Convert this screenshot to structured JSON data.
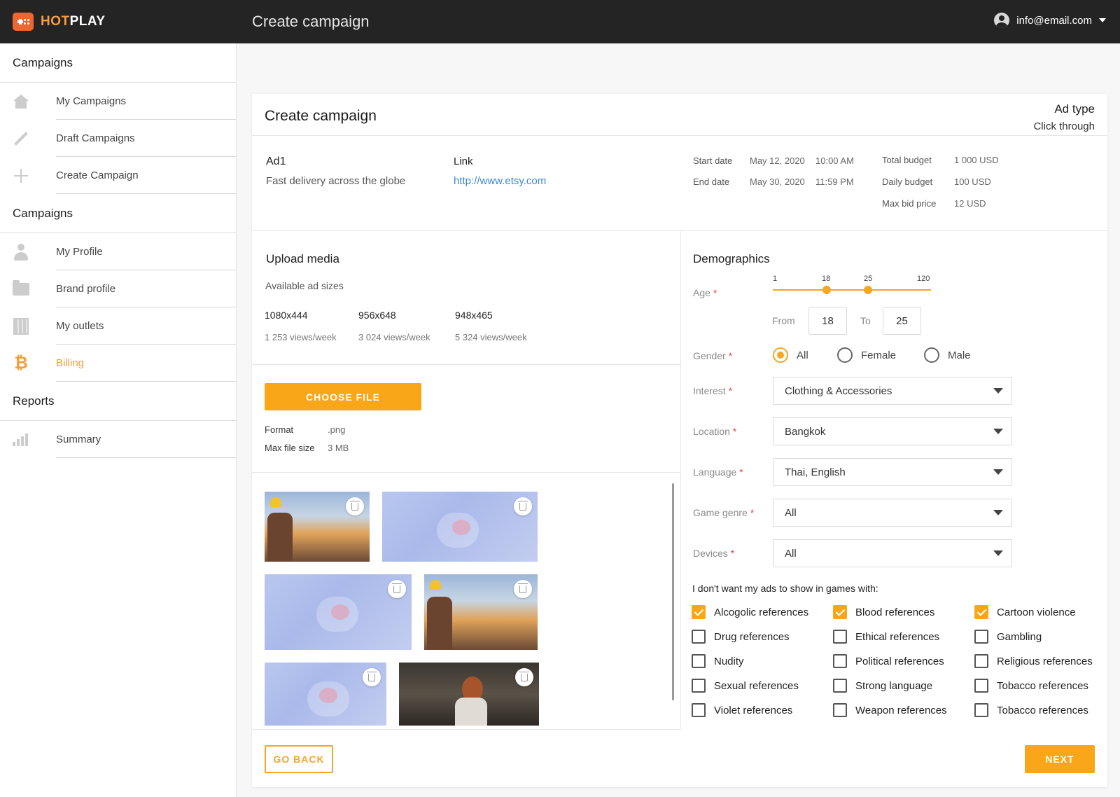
{
  "brand": {
    "hot": "HOT",
    "play": "PLAY",
    "accent": "#f59d3f"
  },
  "topbar": {
    "title": "Create campaign",
    "user_email": "info@email.com"
  },
  "sidebar": {
    "sections": [
      {
        "title": "Campaigns",
        "items": [
          {
            "label": "My Campaigns",
            "icon": "home-icon"
          },
          {
            "label": "Draft Campaigns",
            "icon": "pencil-icon"
          },
          {
            "label": "Create Campaign",
            "icon": "plus-icon"
          }
        ]
      },
      {
        "title": "Campaigns",
        "items": [
          {
            "label": "My Profile",
            "icon": "user-icon"
          },
          {
            "label": "Brand profile",
            "icon": "folder-icon"
          },
          {
            "label": "My outlets",
            "icon": "building-icon"
          },
          {
            "label": "Billing",
            "icon": "bitcoin-icon",
            "active": true
          }
        ]
      },
      {
        "title": "Reports",
        "items": [
          {
            "label": "Summary",
            "icon": "bar-chart-icon"
          }
        ]
      }
    ]
  },
  "card": {
    "title": "Create campaign",
    "ad_type_label": "Ad type",
    "ad_type_value": "Click through"
  },
  "summary": {
    "ad_name": "Ad1",
    "ad_desc": "Fast delivery across the globe",
    "link_label": "Link",
    "link_url": "http://www.etsy.com",
    "start_label": "Start date",
    "start_date": "May 12, 2020",
    "start_time": "10:00 AM",
    "end_label": "End date",
    "end_date": "May 30, 2020",
    "end_time": "11:59 PM",
    "total_budget_label": "Total budget",
    "total_budget": "1 000 USD",
    "daily_budget_label": "Daily budget",
    "daily_budget": "100 USD",
    "max_bid_label": "Max bid price",
    "max_bid": "12 USD"
  },
  "upload": {
    "title": "Upload media",
    "sizes_label": "Available ad sizes",
    "sizes": [
      {
        "size": "1080x444",
        "views": "1 253 views/week"
      },
      {
        "size": "956x648",
        "views": "3 024 views/week"
      },
      {
        "size": "948x465",
        "views": "5 324 views/week"
      }
    ],
    "choose_label": "CHOOSE FILE",
    "format_label": "Format",
    "format_value": ".png",
    "max_size_label": "Max file size",
    "max_size_value": "3 MB"
  },
  "demographics": {
    "title": "Demographics",
    "age_label": "Age",
    "age_ticks": [
      "1",
      "18",
      "25",
      "120"
    ],
    "age_range": {
      "min": 1,
      "max": 120,
      "from": 18,
      "to": 25
    },
    "from_label": "From",
    "to_label": "To",
    "from_value": "18",
    "to_value": "25",
    "gender_label": "Gender",
    "gender_options": [
      "All",
      "Female",
      "Male"
    ],
    "gender_selected": "All",
    "interest_label": "Interest",
    "interest_value": "Clothing & Accessories",
    "location_label": "Location",
    "location_value": "Bangkok",
    "language_label": "Language",
    "language_value": "Thai, English",
    "genre_label": "Game genre",
    "genre_value": "All",
    "devices_label": "Devices",
    "devices_value": "All",
    "exclude_label": "I don't want my ads to show in games with:",
    "exclusions": [
      {
        "label": "Alcogolic references",
        "checked": true
      },
      {
        "label": "Blood references",
        "checked": true
      },
      {
        "label": "Cartoon violence",
        "checked": true
      },
      {
        "label": "Drug references",
        "checked": false
      },
      {
        "label": "Ethical references",
        "checked": false
      },
      {
        "label": "Gambling",
        "checked": false
      },
      {
        "label": "Nudity",
        "checked": false
      },
      {
        "label": "Political references",
        "checked": false
      },
      {
        "label": "Religious references",
        "checked": false
      },
      {
        "label": "Sexual references",
        "checked": false
      },
      {
        "label": "Strong language",
        "checked": false
      },
      {
        "label": "Tobacco references",
        "checked": false
      },
      {
        "label": "Violet references",
        "checked": false
      },
      {
        "label": "Weapon references",
        "checked": false
      },
      {
        "label": "Tobacco references",
        "checked": false
      }
    ]
  },
  "footer": {
    "back_label": "GO BACK",
    "next_label": "NEXT"
  }
}
